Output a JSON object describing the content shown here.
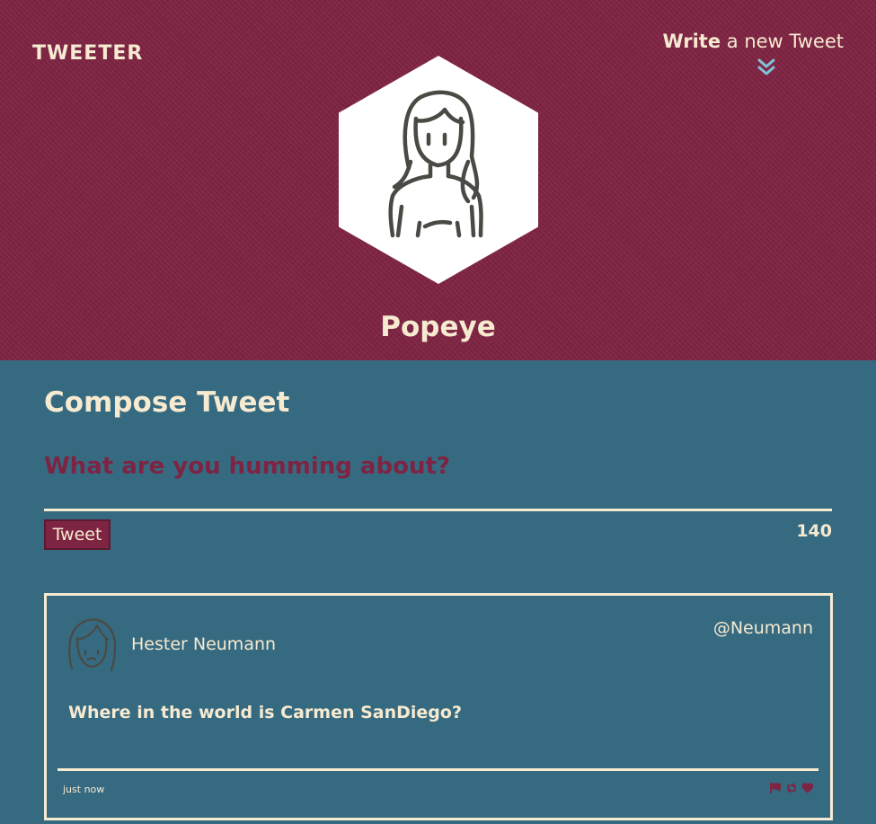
{
  "header": {
    "logo_text": "TWEETER",
    "write_link": {
      "strong": "Write",
      "rest": " a new Tweet"
    },
    "write_arrow_icon": "double-chevron-down-icon",
    "profile_avatar_icon": "woman-avatar-icon",
    "username": "Popeye"
  },
  "compose": {
    "title": "Compose Tweet",
    "placeholder": "What are you humming about?",
    "value": "",
    "button_label": "Tweet",
    "char_count": "140"
  },
  "tweets": [
    {
      "avatar_icon": "woman-avatar-icon",
      "name": "Hester Neumann",
      "handle": "@Neumann",
      "text": "Where in the world is Carmen SanDiego?",
      "time": "just now",
      "actions": [
        "flag-icon",
        "retweet-icon",
        "heart-icon"
      ]
    }
  ],
  "colors": {
    "header_bg": "#7e2443",
    "main_bg": "#366a81",
    "cream": "#f6ead1",
    "accent": "#7e2443",
    "arrow": "#7ec4d8",
    "icon_stroke": "#4a4a44"
  }
}
